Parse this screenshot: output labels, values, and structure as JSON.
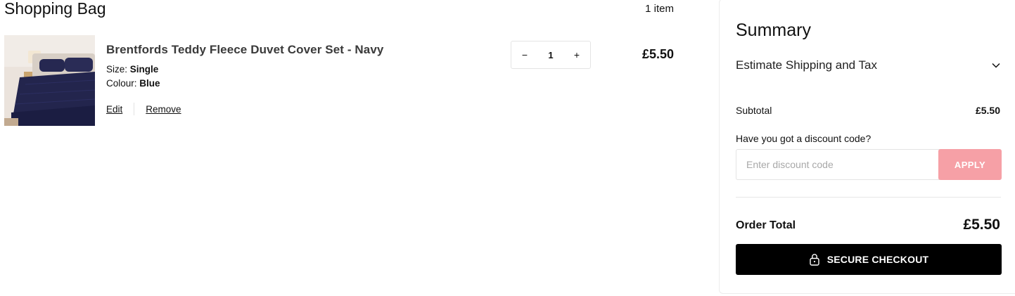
{
  "bag": {
    "title": "Shopping Bag",
    "item_count": "1 item"
  },
  "item": {
    "name": "Brentfords Teddy Fleece Duvet Cover Set - Navy",
    "size_label": "Size:",
    "size_value": "Single",
    "colour_label": "Colour:",
    "colour_value": "Blue",
    "edit_label": "Edit",
    "remove_label": "Remove",
    "qty_decrease": "−",
    "qty_value": "1",
    "qty_increase": "+",
    "price": "£5.50",
    "image_icon": "duvet-product-photo"
  },
  "summary": {
    "title": "Summary",
    "shipping_label": "Estimate Shipping and Tax",
    "shipping_icon": "chevron-down-icon",
    "subtotal_label": "Subtotal",
    "subtotal_value": "£5.50",
    "discount_question": "Have you got a discount code?",
    "discount_placeholder": "Enter discount code",
    "discount_value": "",
    "apply_label": "APPLY",
    "total_label": "Order Total",
    "total_value": "£5.50",
    "checkout_label": "SECURE CHECKOUT",
    "checkout_icon": "lock-icon"
  },
  "colors": {
    "apply_button": "#f6a0a6",
    "checkout_button": "#000000",
    "duvet": "#23254d"
  }
}
